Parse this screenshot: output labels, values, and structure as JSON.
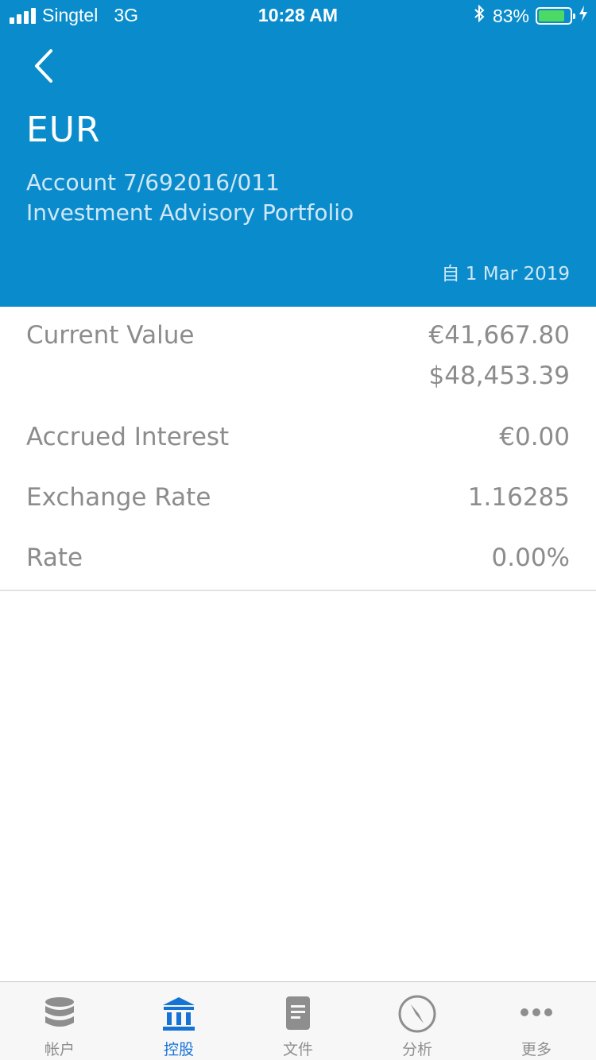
{
  "status_bar": {
    "carrier": "Singtel",
    "network": "3G",
    "time": "10:28 AM",
    "battery": "83%",
    "battery_level": 0.83
  },
  "header": {
    "title": "EUR",
    "account": "Account 7/692016/011",
    "portfolio": "Investment Advisory Portfolio",
    "date": "自 1 Mar 2019",
    "bg_color": "#0a8ccc"
  },
  "details": {
    "current_value": {
      "label": "Current Value",
      "value_eur": "€41,667.80",
      "value_usd": "$48,453.39"
    },
    "accrued_interest": {
      "label": "Accrued Interest",
      "value": "€0.00"
    },
    "exchange_rate": {
      "label": "Exchange Rate",
      "value": "1.16285"
    },
    "rate": {
      "label": "Rate",
      "value": "0.00%"
    }
  },
  "tabs": [
    {
      "label": "帐户",
      "icon": "database-icon",
      "active": false
    },
    {
      "label": "控股",
      "icon": "bank-icon",
      "active": true
    },
    {
      "label": "文件",
      "icon": "document-icon",
      "active": false
    },
    {
      "label": "分析",
      "icon": "compass-icon",
      "active": false
    },
    {
      "label": "更多",
      "icon": "more-icon",
      "active": false
    }
  ],
  "colors": {
    "active_tab": "#1673d6",
    "inactive_tab": "#8e8e8e",
    "text_grey": "#8c8c8c"
  }
}
